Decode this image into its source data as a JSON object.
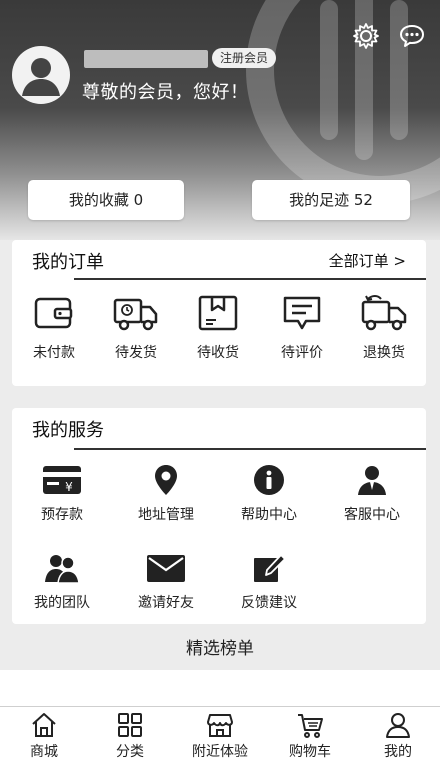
{
  "header": {
    "member_badge": "注册会员",
    "greeting": "尊敬的会员，您好！",
    "favorites": "我的收藏 0",
    "footprints": "我的足迹 52",
    "icons": [
      "settings-icon",
      "message-icon",
      "avatar-icon"
    ]
  },
  "orders": {
    "title": "我的订单",
    "all_link": "全部订单 >",
    "items": [
      {
        "label": "未付款",
        "icon": "wallet-icon"
      },
      {
        "label": "待发货",
        "icon": "truck-icon"
      },
      {
        "label": "待收货",
        "icon": "box-icon"
      },
      {
        "label": "待评价",
        "icon": "comment-icon"
      },
      {
        "label": "退换货",
        "icon": "return-truck-icon"
      }
    ]
  },
  "services": {
    "title": "我的服务",
    "items": [
      {
        "label": "预存款",
        "icon": "card-icon"
      },
      {
        "label": "地址管理",
        "icon": "location-icon"
      },
      {
        "label": "帮助中心",
        "icon": "info-icon"
      },
      {
        "label": "客服中心",
        "icon": "agent-icon"
      },
      {
        "label": "我的团队",
        "icon": "team-icon"
      },
      {
        "label": "邀请好友",
        "icon": "mail-icon"
      },
      {
        "label": "反馈建议",
        "icon": "edit-icon"
      }
    ]
  },
  "ranking_title": "精选榜单",
  "tabbar": [
    {
      "label": "商城",
      "icon": "home-icon"
    },
    {
      "label": "分类",
      "icon": "grid-icon"
    },
    {
      "label": "附近体验",
      "icon": "store-icon"
    },
    {
      "label": "购物车",
      "icon": "cart-icon"
    },
    {
      "label": "我的",
      "icon": "user-icon"
    }
  ]
}
